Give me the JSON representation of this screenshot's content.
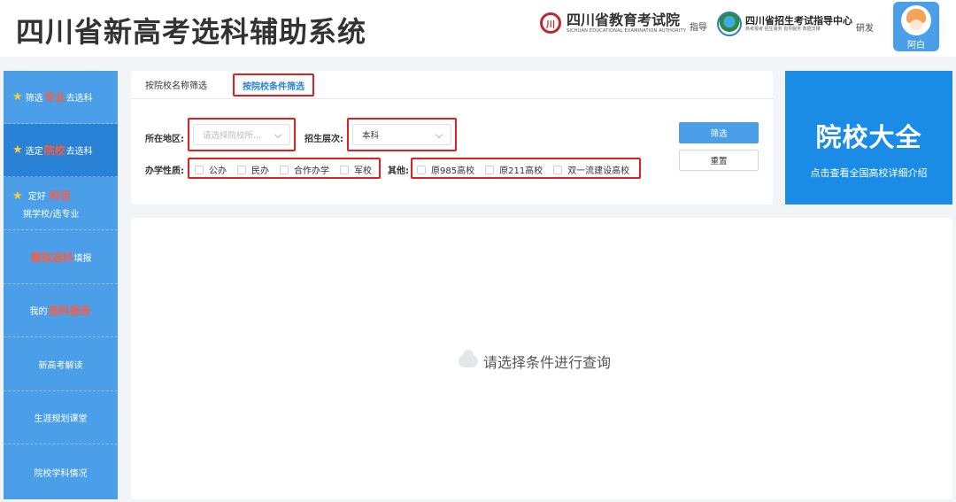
{
  "header": {
    "title": "四川省新高考选科辅助系统",
    "org1": {
      "logo_text": "川",
      "name": "四川省教育考试院",
      "en": "SICHUAN EDUCATIONAL EXAMINATION AUTHORITY"
    },
    "guide_label": "指导",
    "org2": {
      "name": "四川省招生考试指导中心",
      "sub": "高考报考 招生服务 指导服务 数据支撑"
    },
    "dev_label": "研发",
    "user_name": "阿白"
  },
  "sidebar": {
    "items": [
      {
        "pre": "筛选",
        "hl": "专业",
        "post": "去选科"
      },
      {
        "pre": "选定",
        "hl": "院校",
        "post": "去选科"
      },
      {
        "pre": "定好",
        "hl": "科目",
        "sub": "挑学校/选专业"
      },
      {
        "hl": "模拟选科",
        "post": "填报"
      },
      {
        "pre": "我的",
        "hl": "选科报告"
      },
      {
        "label": "新高考解读"
      },
      {
        "label": "生涯规划课堂"
      },
      {
        "label": "院校学科情况"
      }
    ]
  },
  "filter": {
    "tabs": [
      "按院校名称筛选",
      "按院校条件筛选"
    ],
    "region_label": "所在地区:",
    "region_placeholder": "请选择院校所...",
    "level_label": "招生层次:",
    "level_value": "本科",
    "nature_label": "办学性质:",
    "nature_options": [
      "公办",
      "民办",
      "合作办学",
      "军校"
    ],
    "other_label": "其他:",
    "other_options": [
      "原985高校",
      "原211高校",
      "双一流建设高校"
    ],
    "search_button": "筛选",
    "reset_button": "重置"
  },
  "banner": {
    "title": "院校大全",
    "subtitle": "点击查看全国高校详细介绍"
  },
  "result": {
    "empty_text": "请选择条件进行查询"
  },
  "colors": {
    "primary": "#4a9fe8",
    "sidebar_active": "#2a82d6",
    "highlight": "#ff5a3c",
    "annotation_red": "#e02020",
    "banner": "#1a8ce6"
  }
}
